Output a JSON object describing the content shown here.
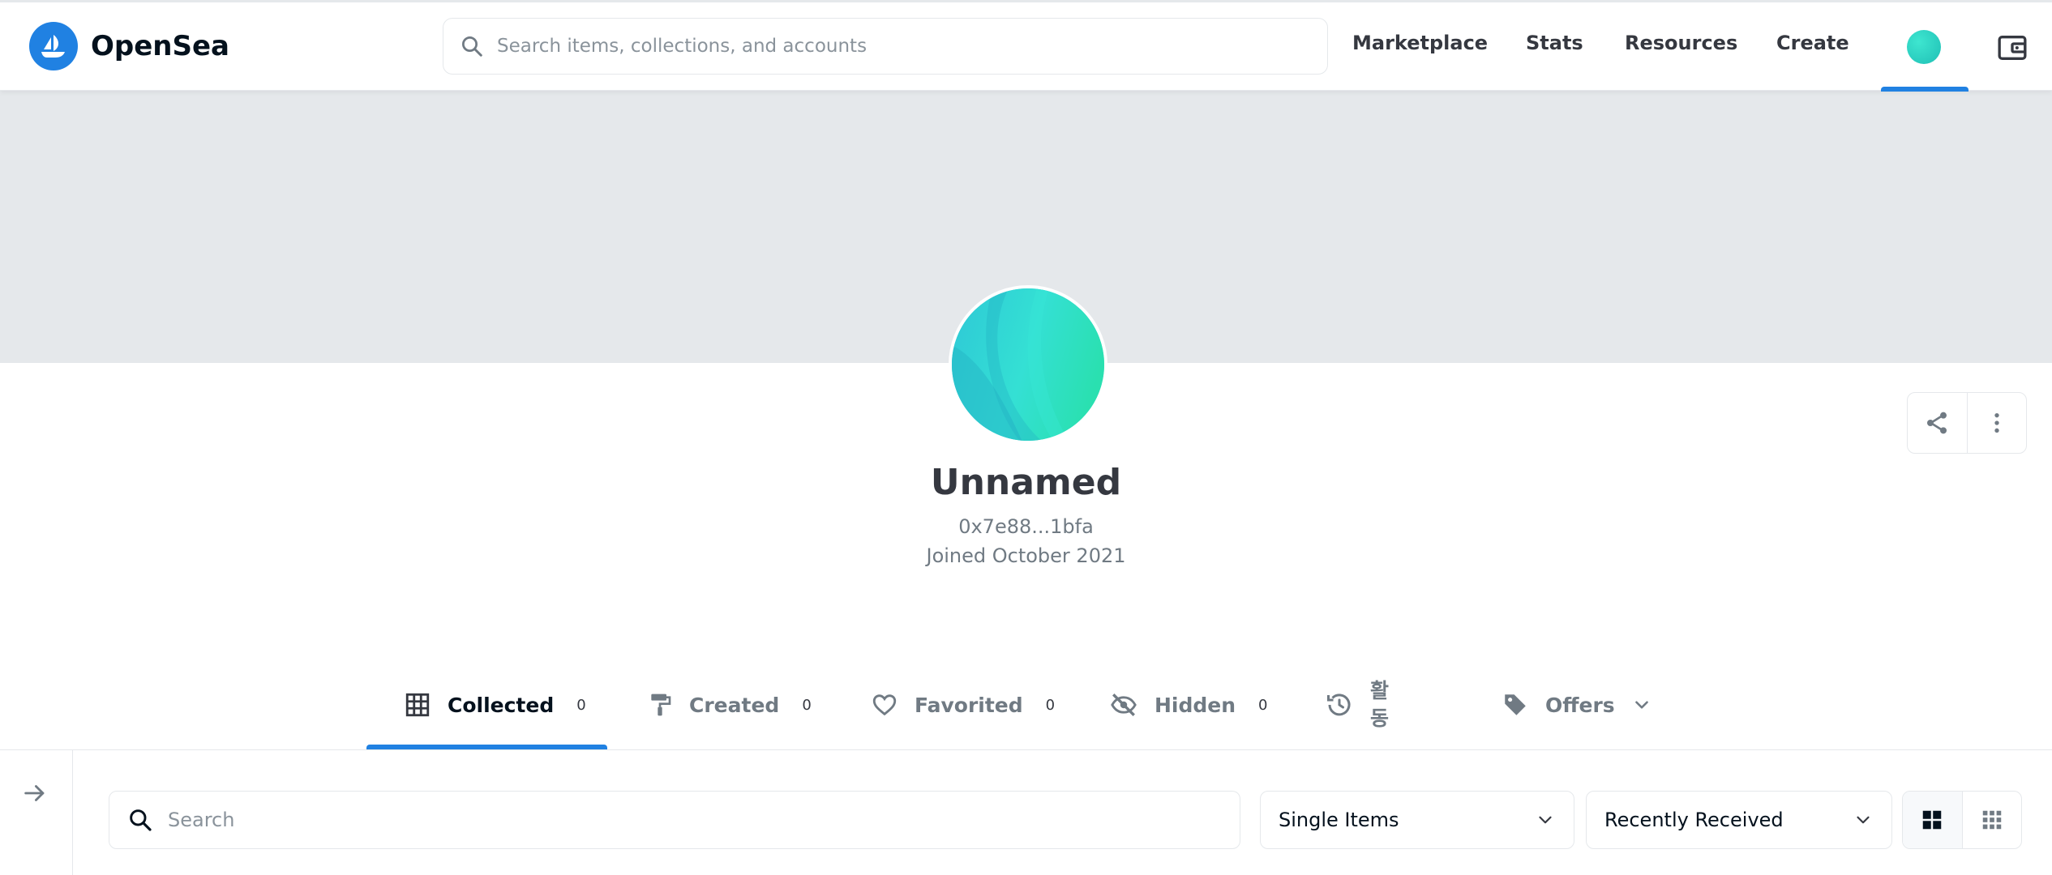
{
  "brand": {
    "name": "OpenSea",
    "color": "#2081e2"
  },
  "header": {
    "search_placeholder": "Search items, collections, and accounts",
    "nav": {
      "marketplace": "Marketplace",
      "stats": "Stats",
      "resources": "Resources",
      "create": "Create"
    },
    "icons": [
      "search-icon",
      "profile-avatar",
      "wallet-icon"
    ]
  },
  "profile": {
    "name": "Unnamed",
    "address": "0x7e88...1bfa",
    "joined": "Joined October 2021",
    "actions": [
      "share-icon",
      "more-vertical-icon"
    ]
  },
  "tabs": {
    "collected": {
      "label": "Collected",
      "count": "0",
      "icon": "grid-icon"
    },
    "created": {
      "label": "Created",
      "count": "0",
      "icon": "paint-roller-icon"
    },
    "favorited": {
      "label": "Favorited",
      "count": "0",
      "icon": "heart-icon"
    },
    "hidden": {
      "label": "Hidden",
      "count": "0",
      "icon": "eye-off-icon"
    },
    "activity": {
      "line1": "활",
      "line2": "동",
      "icon": "history-icon"
    },
    "offers": {
      "label": "Offers",
      "icon": "tag-icon"
    },
    "active": "collected"
  },
  "filters": {
    "search_placeholder": "Search",
    "item_type": "Single Items",
    "sort": "Recently Received",
    "view_modes": [
      "large-grid-icon",
      "small-grid-icon"
    ]
  }
}
